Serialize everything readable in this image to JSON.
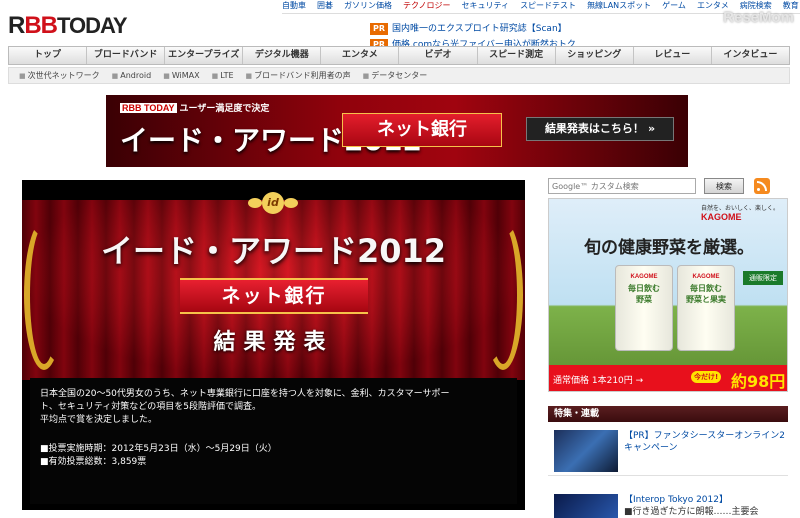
{
  "header": {
    "logo": {
      "r": "R",
      "bb": "BB",
      "today": "TODAY"
    },
    "top_links": [
      "自動車",
      "囲碁",
      "ガソリン価格",
      "テクノロジー",
      "セキュリティ",
      "スピードテスト",
      "無線LANスポット",
      "ゲーム",
      "エンタメ",
      "病院検索",
      "教育・受"
    ],
    "pr_lines": [
      {
        "tag": "PR",
        "text": "国内唯一のエクスプロイト研究誌【Scan】"
      },
      {
        "tag": "PR",
        "text": "価格.comなら光ファイバー申込が断然おトク"
      }
    ],
    "partner_logo": "ReseMom"
  },
  "main_nav": [
    "トップ",
    "ブロードバンド",
    "エンタープライズ",
    "デジタル機器",
    "エンタメ",
    "ビデオ",
    "スピード測定",
    "ショッピング",
    "レビュー",
    "インタビュー"
  ],
  "sub_nav": [
    "次世代ネットワーク",
    "Android",
    "WiMAX",
    "LTE",
    "ブロードバンド利用者の声",
    "データセンター"
  ],
  "top_banner": {
    "brand": "RBB TODAY",
    "brand_caption": "ユーザー満足度で決定",
    "award": "イード・アワード2012",
    "category": "ネット銀行",
    "button": "結果発表はこちら！",
    "button_arrow": "»"
  },
  "hero": {
    "emblem": "id",
    "award": "イード・アワード2012",
    "category": "ネット銀行",
    "result": "結果発表",
    "body": [
      "日本全国の20～50代男女のうち、ネット専業銀行に口座を持つ人を対象に、金利、カスタマーサポー",
      "ト、セキュリティ対策などの項目を5段階評価で調査。",
      "平均点で賞を決定しました。"
    ],
    "period": "■投票実施時期：2012年5月23日（水）～5月29日（火）",
    "votes": "■有効投票総数：3,859票"
  },
  "sidebar": {
    "search_placeholder": "Google™ カスタム検索",
    "search_button": "検索",
    "ad": {
      "tagline": "自然を、おいしく、楽しく。",
      "brand": "KAGOME",
      "headline": "旬の健康野菜を厳選。",
      "can1": [
        "KAGOME",
        "毎日飲む",
        "野菜"
      ],
      "can2": [
        "KAGOME",
        "毎日飲む",
        "野菜と果実"
      ],
      "limited": "通販限定",
      "regular_price": "通常価格 1本210円 →",
      "today_badge": "今だけ!",
      "sale_price": "約98円!"
    },
    "feature_header": "特集・連載",
    "features": [
      {
        "title": "【PR】ファンタシースターオンライン2キャンペーン",
        "sub": ""
      },
      {
        "title": "【Interop Tokyo 2012】",
        "sub": "■行き過ぎた方に朗報……主要会"
      }
    ]
  }
}
